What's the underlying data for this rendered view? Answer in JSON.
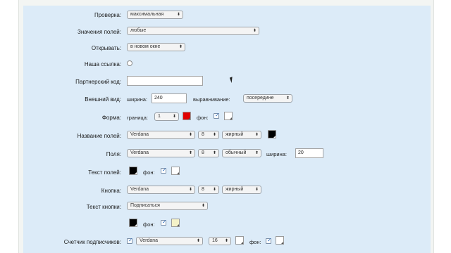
{
  "form": {
    "check": {
      "label": "Проверка:",
      "value": "максимальная"
    },
    "field_values": {
      "label": "Значения полей:",
      "value": "любые"
    },
    "open": {
      "label": "Открывать:",
      "value": "в новом окне"
    },
    "our_link": {
      "label": "Наша ссылка:"
    },
    "partner_code": {
      "label": "Партнерский код:",
      "value": ""
    },
    "appearance": {
      "label": "Внешний вид:",
      "width_label": "ширина:",
      "width_value": "240",
      "align_label": "выравнивание:",
      "align_value": "посередине"
    },
    "shape": {
      "label": "Форма:",
      "border_label": "граница:",
      "border_value": "1",
      "bg_label": "фон:"
    },
    "field_names": {
      "label": "Название полей:",
      "font": "Verdana",
      "size": "8",
      "weight": "жирный"
    },
    "fields": {
      "label": "Поля:",
      "font": "Verdana",
      "size": "8",
      "weight": "обычный",
      "width_label": "ширина:",
      "width_value": "20"
    },
    "field_text": {
      "label": "Текст полей:",
      "bg_label": "фон:"
    },
    "button": {
      "label": "Кнопка:",
      "font": "Verdana",
      "size": "8",
      "weight": "жирный"
    },
    "button_text": {
      "label": "Текст кнопки:",
      "value": "Подписаться",
      "bg_label": "фон:"
    },
    "subscribers": {
      "label": "Счетчик подписчиков:",
      "font": "Verdana",
      "size": "16",
      "bg_label": "фон:"
    }
  },
  "colors": {
    "panel_bg": "#dcebf8",
    "border_red": "#e00000",
    "black": "#000000",
    "white": "#ffffff",
    "light_yellow": "#f4f2c8"
  }
}
